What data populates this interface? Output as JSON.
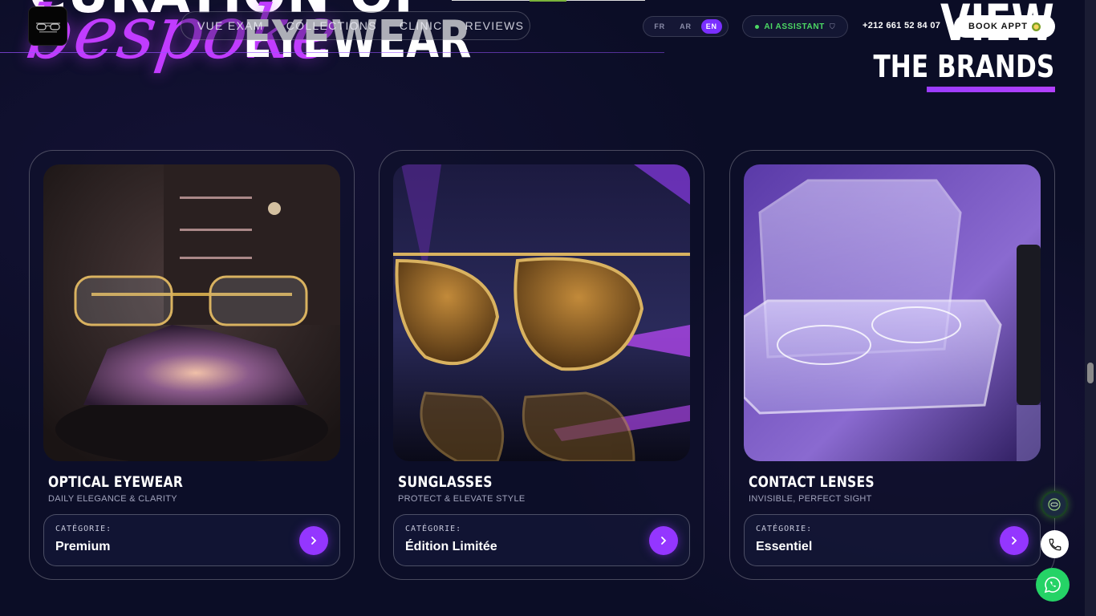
{
  "hero": {
    "line1": "CURATION OF",
    "script": "bespoke",
    "word": "EYEWEAR",
    "view": "VIEW",
    "brands": "THE BRANDS"
  },
  "nav": {
    "items": [
      "VUE EXAM",
      "COLLECTIONS",
      "CLINIC",
      "REVIEWS"
    ]
  },
  "lang": {
    "items": [
      "FR",
      "AR",
      "EN"
    ],
    "active": "EN"
  },
  "ai_assistant": {
    "label": "AI ASSISTANT"
  },
  "phone": "+212 661 52 84 07",
  "book": {
    "label": "BOOK APPT"
  },
  "cards": [
    {
      "title": "OPTICAL EYEWEAR",
      "subtitle": "DAILY ELEGANCE & CLARITY",
      "category_label": "CATÉGORIE:",
      "category_value": "Premium"
    },
    {
      "title": "SUNGLASSES",
      "subtitle": "PROTECT & ELEVATE STYLE",
      "category_label": "CATÉGORIE:",
      "category_value": "Édition Limitée"
    },
    {
      "title": "CONTACT LENSES",
      "subtitle": "INVISIBLE, PERFECT SIGHT",
      "category_label": "CATÉGORIE:",
      "category_value": "Essentiel"
    }
  ],
  "icons": {
    "logo": "glasses-logo-icon",
    "arrow": "chevron-right-icon",
    "phone": "phone-icon",
    "whatsapp": "whatsapp-icon",
    "ai_float": "ai-assistant-icon"
  },
  "colors": {
    "background": "#0b0d26",
    "accent": "#9436ff",
    "script": "#c13cff",
    "ai_green": "#4cd964",
    "whatsapp": "#25d366"
  }
}
